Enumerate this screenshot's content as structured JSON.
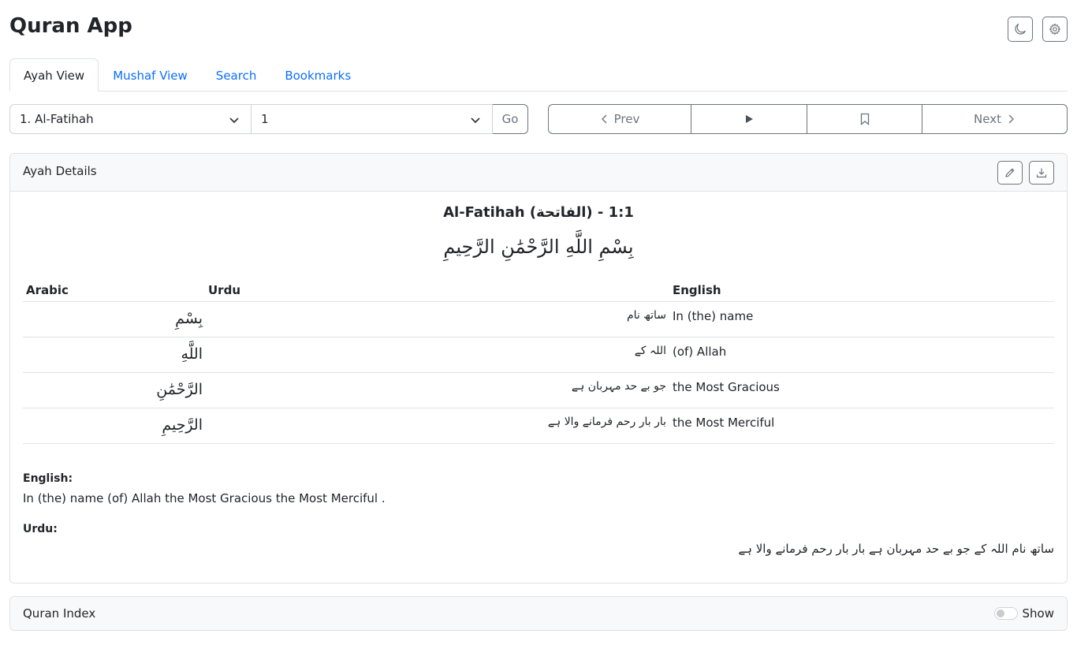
{
  "app": {
    "title": "Quran App"
  },
  "tabs": [
    {
      "label": "Ayah View",
      "active": true
    },
    {
      "label": "Mushaf View",
      "active": false
    },
    {
      "label": "Search",
      "active": false
    },
    {
      "label": "Bookmarks",
      "active": false
    }
  ],
  "selectors": {
    "surah": "1. Al-Fatihah",
    "ayah": "1",
    "go_label": "Go"
  },
  "navigation": {
    "prev_label": "Prev",
    "next_label": "Next"
  },
  "details": {
    "header": "Ayah Details",
    "title": "Al-Fatihah (الفاتحة) - 1:1",
    "arabic": "بِسْمِ اللَّهِ الرَّحْمَٰنِ الرَّحِيمِ",
    "columns": {
      "arabic": "Arabic",
      "urdu": "Urdu",
      "english": "English"
    },
    "words": [
      {
        "arabic": "بِسْمِ",
        "urdu": "ساتھ نام",
        "english": "In (the) name"
      },
      {
        "arabic": "اللَّهِ",
        "urdu": "اللہ کے",
        "english": "(of) Allah"
      },
      {
        "arabic": "الرَّحْمَٰنِ",
        "urdu": "جو بے حد مہربان ہے",
        "english": "the Most Gracious"
      },
      {
        "arabic": "الرَّحِيمِ",
        "urdu": "بار بار رحم فرمانے والا ہے",
        "english": "the Most Merciful"
      }
    ],
    "english_label": "English:",
    "english_text": "In (the) name (of) Allah the Most Gracious the Most Merciful .",
    "urdu_label": "Urdu:",
    "urdu_text": "ساتھ نام اللہ کے جو بے حد مہربان ہے بار بار رحم فرمانے والا ہے"
  },
  "index": {
    "header": "Quran Index",
    "toggle_label": "Show",
    "toggle_on": false
  },
  "colors": {
    "link": "#0d6efd",
    "border": "#dee2e6",
    "secondary": "#6c757d"
  }
}
